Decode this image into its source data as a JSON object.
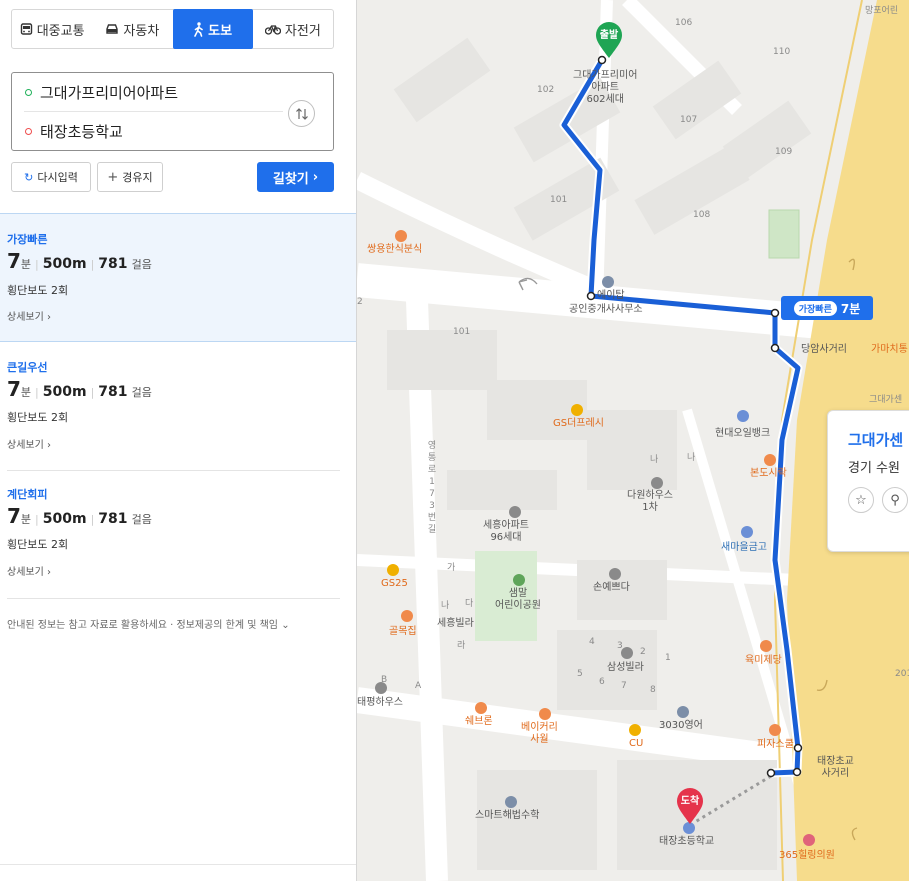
{
  "modes": {
    "transit": "대중교통",
    "car": "자동차",
    "walk": "도보",
    "bike": "자전거"
  },
  "search": {
    "origin": "그대가프리미어아파트",
    "destination": "태장초등학교",
    "reset": "다시입력",
    "waypoint": "경유지",
    "find": "길찾기"
  },
  "routes": [
    {
      "name": "가장빠른",
      "minutes": "7",
      "min_unit": "분",
      "distance": "500m",
      "steps": "781",
      "steps_unit": "걸음",
      "crosswalk": "횡단보도 2회",
      "detail": "상세보기"
    },
    {
      "name": "큰길우선",
      "minutes": "7",
      "min_unit": "분",
      "distance": "500m",
      "steps": "781",
      "steps_unit": "걸음",
      "crosswalk": "횡단보도 2회",
      "detail": "상세보기"
    },
    {
      "name": "계단회피",
      "minutes": "7",
      "min_unit": "분",
      "distance": "500m",
      "steps": "781",
      "steps_unit": "걸음",
      "crosswalk": "횡단보도 2회",
      "detail": "상세보기"
    }
  ],
  "notice": "안내된 정보는 참고 자료로 활용하세요 · 정보제공의 한계 및 책임",
  "map": {
    "start_label": "출발",
    "end_label": "도착",
    "route_tag_pill": "가장빠른",
    "route_tag_time": "7분",
    "info_title": "그대가센",
    "info_addr": "경기 수원",
    "labels": {
      "p106": "106",
      "p110": "110",
      "p102": "102",
      "p107": "107",
      "p109": "109",
      "p101": "101",
      "p108": "108",
      "p101b": "101",
      "p201": "201",
      "p2": "2",
      "mango": "망포어린",
      "apt": "그대가프리미어\n아파트\n602세대",
      "ssangyong": "쌍용한식분식",
      "office": "공인중개사사무소",
      "office2": "에이탑",
      "dangam": "당암사거리",
      "gama": "가마치통",
      "daega2": "그대가센",
      "gs_fresh": "GS더프레시",
      "hyundai": "현대오일뱅크",
      "bondo": "본도시락",
      "dawon": "다원하우스\n1차",
      "sehung": "세흥아파트\n96세대",
      "saemaeul": "새마을금고",
      "gs25": "GS25",
      "saemal": "샘말\n어린이공원",
      "sonyeppeun": "손예쁘다",
      "golmok": "골목집",
      "sehungvilla": "세흥빌라",
      "samsungvilla": "삼성빌라",
      "yukmi": "육미제당",
      "taepyeong": "태평하우스",
      "shebreun": "쉐브론",
      "bakery": "베이커리\n사월",
      "cu": "CU",
      "eng3030": "3030영어",
      "pizza": "피자스쿨",
      "taejang_cross": "태장초교\n사거리",
      "smart": "스마트해법수학",
      "school": "태장초등학교",
      "hilling": "365힐링의원",
      "road": "영통로173번길",
      "na1": "나",
      "na2": "나",
      "ga1": "가",
      "na3": "나",
      "da1": "다",
      "ra1": "라",
      "A": "A",
      "B": "B",
      "n4": "4",
      "n3": "3",
      "n2": "2",
      "n1": "1",
      "n5": "5",
      "n6": "6",
      "n7": "7",
      "n8": "8"
    }
  },
  "colors": {
    "accent": "#1f6feb",
    "route": "#1a5fd6",
    "start": "#1fa554",
    "end": "#e5334b",
    "road_main": "#f7e19a"
  }
}
